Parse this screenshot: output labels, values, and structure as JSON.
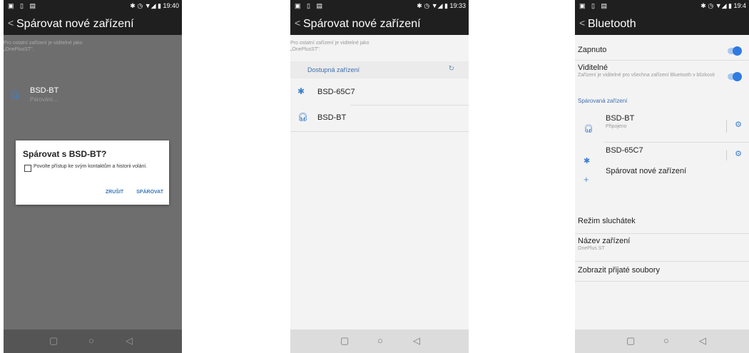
{
  "status": {
    "icons_left": "▣ ▯ ▤",
    "icons_right_1": "✱ ◷ ▼◢ ▮ 19:40",
    "icons_right_2": "✱ ◷ ▼◢ ▮ 19:33",
    "icons_right_3": "✱ ◷ ▼◢ ▮ 19:4"
  },
  "phone1": {
    "title": "Spárovat nové zařízení",
    "visible_info_line1": "Pro ostatní zařízení je viditelné jako",
    "visible_info_line2": "„OnePlusST\".",
    "device": {
      "name": "BSD-BT",
      "status": "Párování..."
    },
    "dialog": {
      "title": "Spárovat s BSD-BT?",
      "checkbox_label": "Povolte přístup ke svým kontaktům a historii volání.",
      "cancel": "ZRUŠIT",
      "pair": "SPÁROVAT"
    }
  },
  "phone2": {
    "title": "Spárovat nové zařízení",
    "visible_info_line1": "Pro ostatní zařízení je viditelné jako",
    "visible_info_line2": "„OnePlusST\".",
    "section": "Dostupná zařízení",
    "devices": [
      {
        "name": "BSD-65C7",
        "icon": "bluetooth-icon"
      },
      {
        "name": "BSD-BT",
        "icon": "headphones-icon"
      }
    ]
  },
  "phone3": {
    "title": "Bluetooth",
    "on_label": "Zapnuto",
    "visible_label": "Viditelné",
    "visible_sub": "Zařízení je viditelné pro všechna zařízení Bluetooth v blízkosti",
    "paired_section": "Spárovaná zařízení",
    "paired": [
      {
        "name": "BSD-BT",
        "sub": "Připojeno",
        "icon": "headphones-icon"
      },
      {
        "name": "BSD-65C7",
        "sub": "",
        "icon": "bluetooth-icon"
      }
    ],
    "pair_new": "Spárovat nové zařízení",
    "headset_mode": "Režim sluchátek",
    "device_name_label": "Název zařízení",
    "device_name_value": "OnePlus ST",
    "received_files": "Zobrazit přijaté soubory"
  },
  "colors": {
    "accent": "#2f7be0",
    "section_blue": "#3f6fb0",
    "dark_bar": "#1f1f1f"
  }
}
